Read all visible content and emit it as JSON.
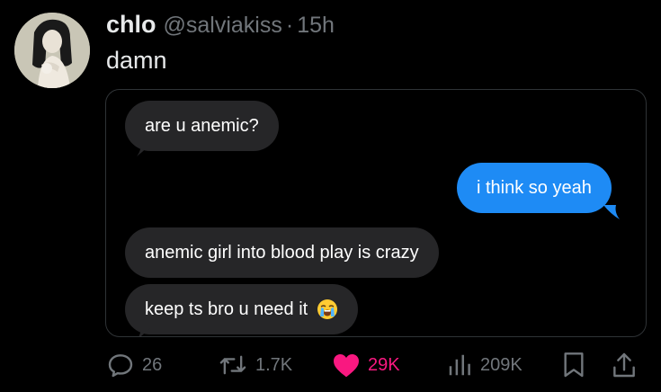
{
  "post": {
    "display_name": "chlo",
    "handle": "@salviakiss",
    "separator": "·",
    "time": "15h",
    "text": "damn"
  },
  "messages": [
    {
      "direction": "received",
      "text": "are u anemic?"
    },
    {
      "direction": "sent",
      "text": "i think so yeah"
    },
    {
      "direction": "received",
      "text": "anemic girl into blood play is crazy"
    },
    {
      "direction": "received",
      "text": "keep ts bro u need it",
      "emoji": "loudly-crying-face"
    }
  ],
  "actions": {
    "replies": "26",
    "reposts": "1.7K",
    "likes": "29K",
    "views": "209K"
  },
  "colors": {
    "background": "#000000",
    "sent_bubble": "#1e8bf5",
    "received_bubble": "#262628",
    "like_active": "#f91880",
    "muted": "#71767b"
  },
  "icons": [
    "reply-icon",
    "repost-icon",
    "like-icon",
    "views-icon",
    "bookmark-icon",
    "share-icon",
    "loudly-crying-face-emoji"
  ]
}
